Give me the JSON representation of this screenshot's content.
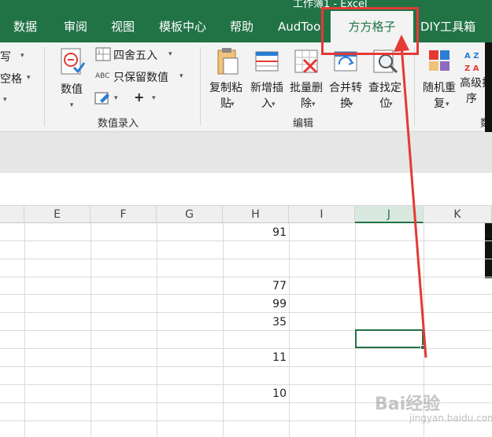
{
  "window": {
    "title_partial": "工作簿1 - Excel"
  },
  "tabs": [
    {
      "label": "数据"
    },
    {
      "label": "审阅"
    },
    {
      "label": "视图"
    },
    {
      "label": "模板中心"
    },
    {
      "label": "帮助"
    },
    {
      "label": "AudTool"
    },
    {
      "label": "方方格子",
      "active": true
    },
    {
      "label": "DIY工具箱"
    }
  ],
  "ribbon": {
    "partial_left": [
      "写",
      "空格",
      ""
    ],
    "number_group": {
      "value_button": "数值",
      "round_button": "四舍五入",
      "keep_value_button": "只保留数值",
      "abc_icon_text": "ABC",
      "plus_text": "+",
      "group_label": "数值录入"
    },
    "edit_group": {
      "copy_paste_1": "复制粘",
      "copy_paste_2": "贴",
      "insert_1": "新增插",
      "insert_2": "入",
      "batch_delete_1": "批量删",
      "batch_delete_2": "除",
      "merge_1": "合并转",
      "merge_2": "换",
      "find_1": "查找定",
      "find_2": "位",
      "group_label": "编辑"
    },
    "right_group": {
      "random_1": "随机重",
      "random_2": "复",
      "sort_1": "高级排",
      "sort_2": "序",
      "sort_icon_top": "A Z",
      "sort_icon_bottom": "Z A",
      "partial_label": "数"
    }
  },
  "grid": {
    "columns": [
      "E",
      "F",
      "G",
      "H",
      "I",
      "J",
      "K"
    ],
    "selected_column": "J",
    "h_values": [
      "91",
      "77",
      "99",
      "35",
      "11",
      "10"
    ]
  },
  "watermark": {
    "text": "Bai经验",
    "sub": "jingyan.baidu.com"
  },
  "colors": {
    "excel_green": "#217346",
    "annotation_red": "#e53935"
  }
}
